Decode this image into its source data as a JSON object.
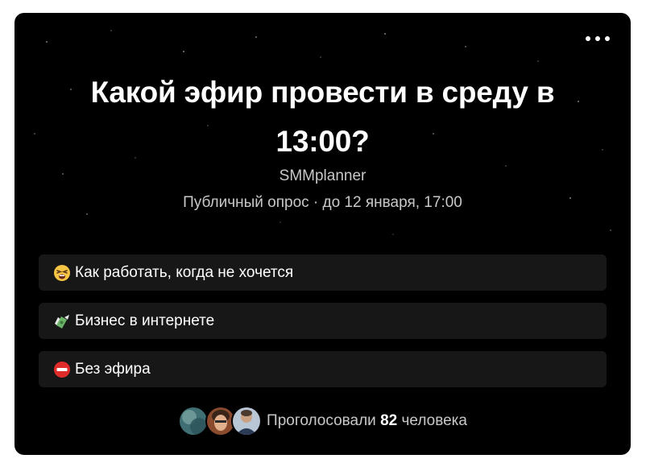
{
  "poll": {
    "title": "Какой эфир провести в среду в 13:00?",
    "author": "SMMplanner",
    "meta": "Публичный опрос · до 12 января, 17:00",
    "options": [
      {
        "emoji": "tired-face-icon",
        "label": "Как работать, когда не хочется"
      },
      {
        "emoji": "money-with-wings-icon",
        "label": "Бизнес в интернете"
      },
      {
        "emoji": "no-entry-icon",
        "label": "Без эфира"
      }
    ],
    "voters": {
      "prefix": "Проголосовали",
      "count": "82",
      "suffix": "человека"
    }
  },
  "colors": {
    "background": "#000000",
    "option_bg": "#171717",
    "text_primary": "#ffffff",
    "text_secondary": "#c8c8c8"
  }
}
